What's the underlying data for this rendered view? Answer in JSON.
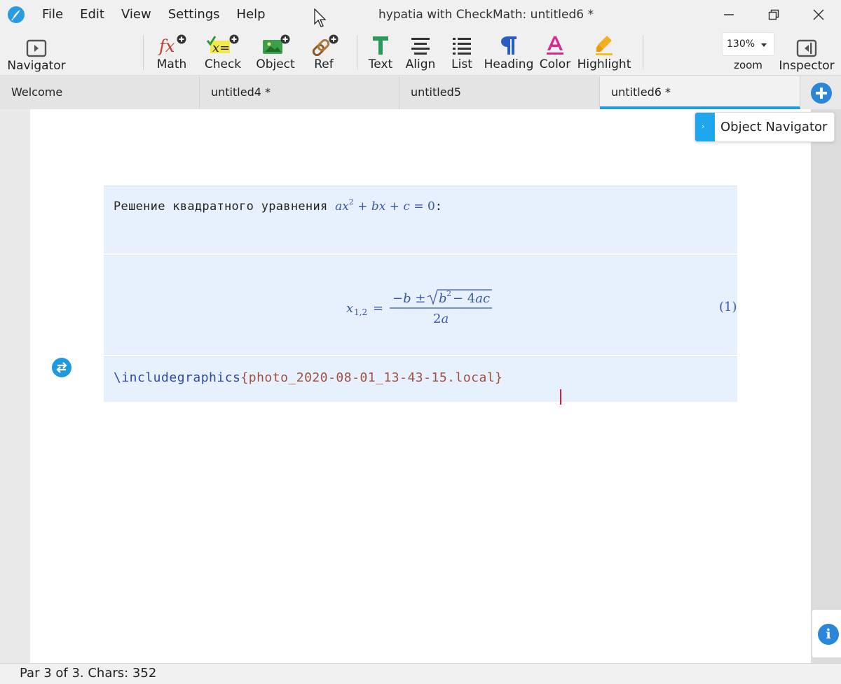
{
  "window": {
    "title": "hypatia with CheckMath: untitled6 *"
  },
  "menu": [
    "File",
    "Edit",
    "View",
    "Settings",
    "Help"
  ],
  "toolbar": {
    "navigator": "Navigator",
    "math": "Math",
    "check": "Check",
    "object": "Object",
    "ref": "Ref",
    "text": "Text",
    "align": "Align",
    "list": "List",
    "heading": "Heading",
    "color": "Color",
    "highlight": "Highlight",
    "zoom_value": "130%",
    "zoom_label": "zoom",
    "inspector": "Inspector"
  },
  "tabs": [
    {
      "label": "Welcome",
      "active": false
    },
    {
      "label": "untitled4 *",
      "active": false
    },
    {
      "label": "untitled5",
      "active": false
    },
    {
      "label": "untitled6 *",
      "active": true
    }
  ],
  "object_navigator": {
    "label": "Object Navigator"
  },
  "document": {
    "paragraph1_text": "Решение квадратного уравнения",
    "paragraph1_math": "ax² + bx + c = 0",
    "paragraph1_suffix": ":",
    "equation": "x₁,₂ = (−b ± √(b² − 4ac)) / 2a",
    "equation_number": "(1)",
    "latex_command": "\\includegraphics",
    "latex_argument": "{photo_2020-08-01_13-43-15.local}"
  },
  "status": {
    "text": "Par 3 of 3. Chars: 352"
  },
  "colors": {
    "accent": "#1e9be0",
    "math_blue": "#3b55a8",
    "block_bg": "#e7f1fd",
    "latex_arg": "#a0503c",
    "caret": "#e11d3a"
  }
}
